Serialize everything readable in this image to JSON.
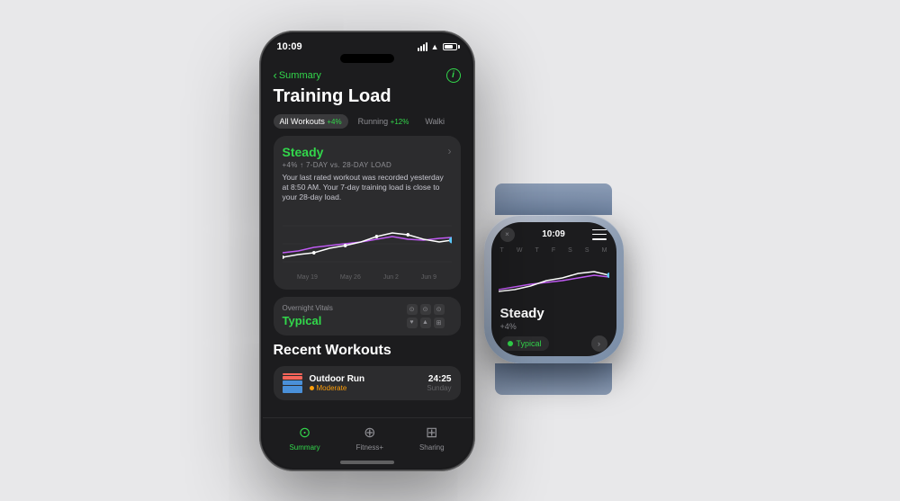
{
  "background_color": "#e8e8ea",
  "phone": {
    "time": "10:09",
    "back_label": "Summary",
    "page_title": "Training Load",
    "info_icon": "ℹ",
    "tabs": [
      {
        "label": "All Workouts",
        "badge": "+4%",
        "active": true
      },
      {
        "label": "Running",
        "badge": "+12%",
        "active": false
      },
      {
        "label": "Walki",
        "badge": "",
        "active": false
      }
    ],
    "training_card": {
      "status": "Steady",
      "subtitle": "+4% ↑ 7-DAY vs. 28-DAY LOAD",
      "description": "Your last rated workout was recorded yesterday at 8:50 AM. Your 7-day training load is close to your 28-day load.",
      "chevron": "›",
      "chart_dates": [
        "May 19",
        "May 26",
        "Jun 2",
        "Jun 9"
      ]
    },
    "overnight_vitals": {
      "label": "Overnight Vitals",
      "value": "Typical"
    },
    "recent_workouts_title": "Recent Workouts",
    "workouts": [
      {
        "name": "Outdoor Run",
        "intensity": "Moderate",
        "duration": "24:25",
        "day": "Sunday"
      }
    ],
    "bottom_nav": [
      {
        "label": "Summary",
        "icon": "⊙",
        "active": true
      },
      {
        "label": "Fitness+",
        "icon": "⊕",
        "active": false
      },
      {
        "label": "Sharing",
        "icon": "⊞",
        "active": false
      }
    ]
  },
  "watch": {
    "time": "10:09",
    "steady_label": "Steady",
    "percent_label": "+4%",
    "typical_label": "Typical",
    "chart_days": [
      "T",
      "W",
      "T",
      "F",
      "S",
      "S",
      "M"
    ],
    "x_btn": "×",
    "menu_lines": 3
  }
}
